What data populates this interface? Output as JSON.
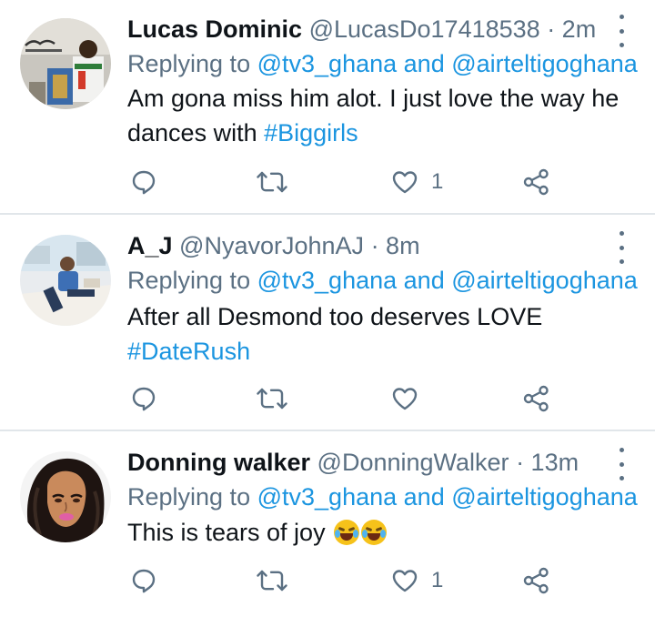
{
  "colors": {
    "accent": "#1b95e0",
    "muted": "#5b7083",
    "divider": "#e1e6ea"
  },
  "icons": {
    "reply": "reply-icon",
    "retweet": "retweet-icon",
    "like": "heart-icon",
    "share": "share-icon",
    "more": "more-vertical-icon"
  },
  "tweets": [
    {
      "name": "Lucas Dominic",
      "handle": "@LucasDo17418538",
      "time": "· 2m",
      "reply_prefix": "Replying to",
      "reply_to_1": "@tv3_ghana",
      "reply_and": "and",
      "reply_to_2": "@airteltigoghana",
      "text": "Am gona miss him alot. I just love the way he dances with",
      "hashtag": "#Biggirls",
      "like_count": "1"
    },
    {
      "name": "A_J",
      "handle": "@NyavorJohnAJ",
      "time": "· 8m",
      "reply_prefix": "Replying to",
      "reply_to_1": "@tv3_ghana",
      "reply_and": "and",
      "reply_to_2": "@airteltigoghana",
      "text": "After all Desmond too deserves LOVE",
      "hashtag": "#DateRush",
      "like_count": ""
    },
    {
      "name": "Donning walker",
      "handle": "@DonningWalker",
      "time": "· 13m",
      "reply_prefix": "Replying to",
      "reply_to_1": "@tv3_ghana",
      "reply_and": "and",
      "reply_to_2": "@airteltigoghana",
      "text": "This is tears of joy",
      "hashtag": "",
      "like_count": "1"
    }
  ]
}
